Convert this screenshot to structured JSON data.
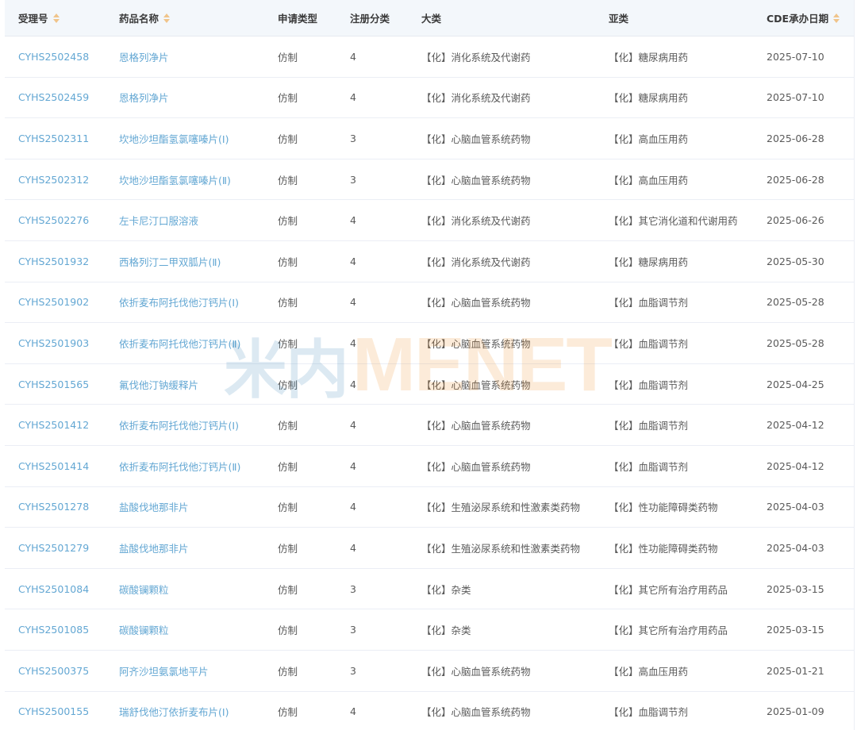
{
  "table": {
    "headers": {
      "accept_no": "受理号",
      "drug_name": "药品名称",
      "apply_type": "申请类型",
      "reg_class": "注册分类",
      "category": "大类",
      "subcategory": "亚类",
      "cde_date": "CDE承办日期"
    },
    "rows": [
      {
        "accept_no": "CYHS2502458",
        "drug_name": "恩格列净片",
        "apply_type": "仿制",
        "reg_class": "4",
        "category": "【化】消化系统及代谢药",
        "subcategory": "【化】糖尿病用药",
        "cde_date": "2025-07-10"
      },
      {
        "accept_no": "CYHS2502459",
        "drug_name": "恩格列净片",
        "apply_type": "仿制",
        "reg_class": "4",
        "category": "【化】消化系统及代谢药",
        "subcategory": "【化】糖尿病用药",
        "cde_date": "2025-07-10"
      },
      {
        "accept_no": "CYHS2502311",
        "drug_name": "坎地沙坦酯氢氯噻嗪片(Ⅰ)",
        "apply_type": "仿制",
        "reg_class": "3",
        "category": "【化】心脑血管系统药物",
        "subcategory": "【化】高血压用药",
        "cde_date": "2025-06-28"
      },
      {
        "accept_no": "CYHS2502312",
        "drug_name": "坎地沙坦酯氢氯噻嗪片(Ⅱ)",
        "apply_type": "仿制",
        "reg_class": "3",
        "category": "【化】心脑血管系统药物",
        "subcategory": "【化】高血压用药",
        "cde_date": "2025-06-28"
      },
      {
        "accept_no": "CYHS2502276",
        "drug_name": "左卡尼汀口服溶液",
        "apply_type": "仿制",
        "reg_class": "4",
        "category": "【化】消化系统及代谢药",
        "subcategory": "【化】其它消化道和代谢用药",
        "cde_date": "2025-06-26"
      },
      {
        "accept_no": "CYHS2501932",
        "drug_name": "西格列汀二甲双胍片(Ⅱ)",
        "apply_type": "仿制",
        "reg_class": "4",
        "category": "【化】消化系统及代谢药",
        "subcategory": "【化】糖尿病用药",
        "cde_date": "2025-05-30"
      },
      {
        "accept_no": "CYHS2501902",
        "drug_name": "依折麦布阿托伐他汀钙片(Ⅰ)",
        "apply_type": "仿制",
        "reg_class": "4",
        "category": "【化】心脑血管系统药物",
        "subcategory": "【化】血脂调节剂",
        "cde_date": "2025-05-28"
      },
      {
        "accept_no": "CYHS2501903",
        "drug_name": "依折麦布阿托伐他汀钙片(Ⅱ)",
        "apply_type": "仿制",
        "reg_class": "4",
        "category": "【化】心脑血管系统药物",
        "subcategory": "【化】血脂调节剂",
        "cde_date": "2025-05-28"
      },
      {
        "accept_no": "CYHS2501565",
        "drug_name": "氟伐他汀钠缓释片",
        "apply_type": "仿制",
        "reg_class": "4",
        "category": "【化】心脑血管系统药物",
        "subcategory": "【化】血脂调节剂",
        "cde_date": "2025-04-25"
      },
      {
        "accept_no": "CYHS2501412",
        "drug_name": "依折麦布阿托伐他汀钙片(Ⅰ)",
        "apply_type": "仿制",
        "reg_class": "4",
        "category": "【化】心脑血管系统药物",
        "subcategory": "【化】血脂调节剂",
        "cde_date": "2025-04-12"
      },
      {
        "accept_no": "CYHS2501414",
        "drug_name": "依折麦布阿托伐他汀钙片(Ⅱ)",
        "apply_type": "仿制",
        "reg_class": "4",
        "category": "【化】心脑血管系统药物",
        "subcategory": "【化】血脂调节剂",
        "cde_date": "2025-04-12"
      },
      {
        "accept_no": "CYHS2501278",
        "drug_name": "盐酸伐地那非片",
        "apply_type": "仿制",
        "reg_class": "4",
        "category": "【化】生殖泌尿系统和性激素类药物",
        "subcategory": "【化】性功能障碍类药物",
        "cde_date": "2025-04-03"
      },
      {
        "accept_no": "CYHS2501279",
        "drug_name": "盐酸伐地那非片",
        "apply_type": "仿制",
        "reg_class": "4",
        "category": "【化】生殖泌尿系统和性激素类药物",
        "subcategory": "【化】性功能障碍类药物",
        "cde_date": "2025-04-03"
      },
      {
        "accept_no": "CYHS2501084",
        "drug_name": "碳酸镧颗粒",
        "apply_type": "仿制",
        "reg_class": "3",
        "category": "【化】杂类",
        "subcategory": "【化】其它所有治疗用药品",
        "cde_date": "2025-03-15"
      },
      {
        "accept_no": "CYHS2501085",
        "drug_name": "碳酸镧颗粒",
        "apply_type": "仿制",
        "reg_class": "3",
        "category": "【化】杂类",
        "subcategory": "【化】其它所有治疗用药品",
        "cde_date": "2025-03-15"
      },
      {
        "accept_no": "CYHS2500375",
        "drug_name": "阿齐沙坦氨氯地平片",
        "apply_type": "仿制",
        "reg_class": "3",
        "category": "【化】心脑血管系统药物",
        "subcategory": "【化】高血压用药",
        "cde_date": "2025-01-21"
      },
      {
        "accept_no": "CYHS2500155",
        "drug_name": "瑞舒伐他汀依折麦布片(Ⅰ)",
        "apply_type": "仿制",
        "reg_class": "4",
        "category": "【化】心脑血管系统药物",
        "subcategory": "【化】血脂调节剂",
        "cde_date": "2025-01-09"
      }
    ]
  },
  "watermark": {
    "cn": "米内",
    "en": "MENET"
  },
  "colors": {
    "link": "#63a7d3",
    "header_bg": "#f3f7fb",
    "sort_active": "#f0c48a",
    "sort_inactive": "#c0c4cc"
  },
  "icons": {
    "sort": "sort-caret-icon"
  }
}
